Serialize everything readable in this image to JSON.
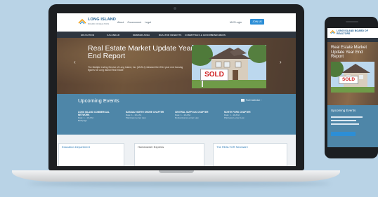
{
  "site": {
    "logo_line1": "LONG ISLAND",
    "logo_line2": "BOARD OF REALTORS",
    "top_links": [
      "About",
      "Government",
      "Legal"
    ],
    "member_login": "MLS Login",
    "join_label": "JOIN US"
  },
  "nav": [
    "EDUCATION",
    "CALENDAR",
    "MEMBER AREA",
    "REALTOR BENEFITS",
    "COMMITTEES & GROUPS",
    "CONSUMERS"
  ],
  "hero": {
    "title": "Real Estate Market Update Year End Report",
    "text": "The Multiple Listing Service of Long Island, Inc. (MLSLI) released the 2014 year end housing figures for Long Island Real Estate",
    "sign": "SOLD",
    "arrow_prev": "‹",
    "arrow_next": "›"
  },
  "events": {
    "title": "Upcoming Events",
    "full_calendar": "Full Calendar ›",
    "items": [
      {
        "name": "LONG ISLAND COMMERCIAL NETWORK",
        "date": "Date: 1 - 10 A.M.",
        "place": "Bethpage"
      },
      {
        "name": "NASSAU NORTH SHORE CHAPTER",
        "date": "Date: 1 - 10 A.M.",
        "place": "Plainview Lerner Law"
      },
      {
        "name": "CENTRAL SUFFOLK CHAPTER",
        "date": "Date: 1 - 10 A.M.",
        "place": "Ronkonkoma Lerner Law"
      },
      {
        "name": "NORTH FORK CHAPTER",
        "date": "Date: 1 - 10 A.M.",
        "place": "Plainview Lerner Law"
      }
    ]
  },
  "cards": [
    "Education Department",
    "Homeowner Express",
    "The REALTOR Newswire"
  ],
  "phone": {
    "logo": "LONG ISLAND BOARD OF REALTORS",
    "hero_title": "Real Estate Market Update Year End Report",
    "sign": "SOLD",
    "events_title": "Upcoming Events"
  }
}
